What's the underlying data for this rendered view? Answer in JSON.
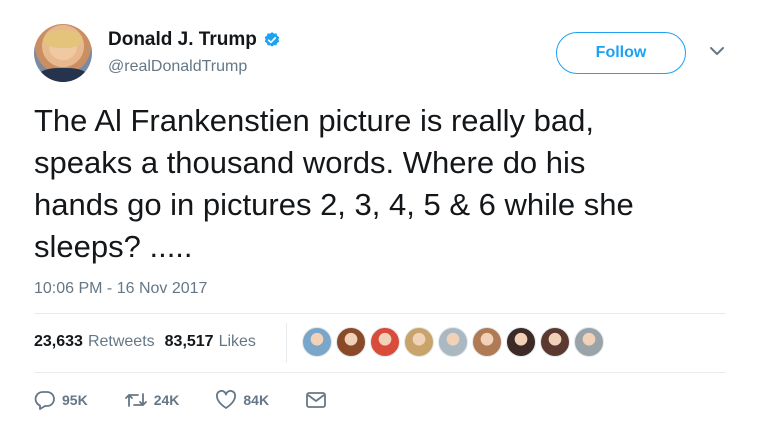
{
  "author": {
    "display_name": "Donald J. Trump",
    "handle": "@realDonaldTrump",
    "verified": true,
    "verified_color": "#1da1f2"
  },
  "follow_label": "Follow",
  "tweet": {
    "lines": [
      "The Al Frankenstien picture is really bad,",
      "speaks a thousand words. Where do his",
      "hands go in pictures 2, 3, 4, 5 & 6 while she",
      "sleeps? ....."
    ],
    "timestamp": "10:06 PM - 16 Nov 2017"
  },
  "stats": {
    "retweets_count": "23,633",
    "retweets_label": "Retweets",
    "likes_count": "83,517",
    "likes_label": "Likes"
  },
  "likers": [
    {
      "name": "liker-avatar-1",
      "color": "#7aa6c9"
    },
    {
      "name": "liker-avatar-2",
      "color": "#8a4a2a"
    },
    {
      "name": "liker-avatar-3",
      "color": "#d94b3b"
    },
    {
      "name": "liker-avatar-4",
      "color": "#c8a46a"
    },
    {
      "name": "liker-avatar-5",
      "color": "#aab8c2"
    },
    {
      "name": "liker-avatar-6",
      "color": "#b07a55"
    },
    {
      "name": "liker-avatar-7",
      "color": "#3b2a26"
    },
    {
      "name": "liker-avatar-8",
      "color": "#5a3a30"
    },
    {
      "name": "liker-avatar-9",
      "color": "#9aa3a8"
    }
  ],
  "actions": {
    "reply_count": "95K",
    "retweet_count": "24K",
    "like_count": "84K"
  },
  "colors": {
    "accent": "#1da1f2",
    "muted": "#657786",
    "text": "#14171a"
  }
}
